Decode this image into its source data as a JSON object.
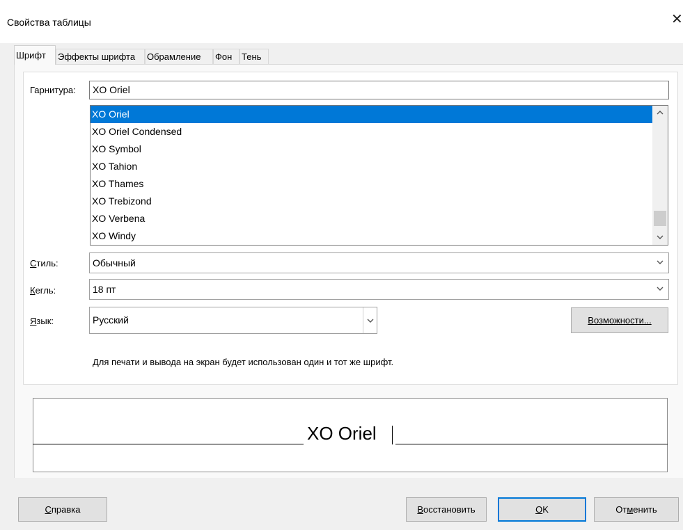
{
  "window": {
    "title": "Свойства таблицы",
    "close_glyph": "✕"
  },
  "tabs": [
    {
      "label": "Шрифт",
      "active": true
    },
    {
      "label": "Эффекты шрифта",
      "active": false
    },
    {
      "label": "Обрамление",
      "active": false
    },
    {
      "label": "Фон",
      "active": false
    },
    {
      "label": "Тень",
      "active": false
    }
  ],
  "font": {
    "family_label": "Гарнитура:",
    "family_value": "XO Oriel",
    "list": [
      "XO Oriel",
      "XO Oriel Condensed",
      "XO Symbol",
      "XO Tahion",
      "XO Thames",
      "XO Trebizond",
      "XO Verbena",
      "XO Windy"
    ],
    "selected_index": 0,
    "style_label": "Стиль:",
    "style_value": "Обычный",
    "size_label": "Кегль:",
    "size_value": "18 пт",
    "language_label": "Язык:",
    "language_value": "Русский",
    "features_button": "Возможности...",
    "info_text": "Для печати и вывода на экран будет использован один и тот же шрифт."
  },
  "preview": {
    "text": "XO Oriel"
  },
  "buttons": {
    "help": "Справка",
    "reset": "Восстановить",
    "ok": "OK",
    "cancel": "Отменить"
  },
  "icons": {
    "scroll_up": "chevron-up-icon",
    "scroll_down": "chevron-down-icon",
    "dropdown": "chevron-down-icon",
    "close": "close-icon"
  },
  "colors": {
    "selection": "#0078d7",
    "default_button_border": "#0078d7"
  }
}
